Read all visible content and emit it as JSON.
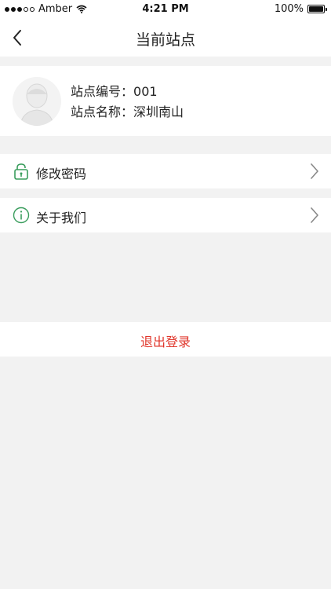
{
  "status_bar": {
    "carrier": "Amber",
    "time": "4:21 PM",
    "battery": "100%"
  },
  "nav": {
    "title": "当前站点",
    "back_icon": "chevron-left-icon"
  },
  "station": {
    "number_label": "站点编号：",
    "number_value": "001",
    "name_label": "站点名称：",
    "name_value": "深圳南山"
  },
  "menu": {
    "change_password": "修改密码",
    "about_us": "关于我们"
  },
  "logout": {
    "label": "退出登录"
  },
  "colors": {
    "accent_green": "#3a9d5d",
    "logout_red": "#e0362b",
    "background": "#f2f2f2"
  }
}
